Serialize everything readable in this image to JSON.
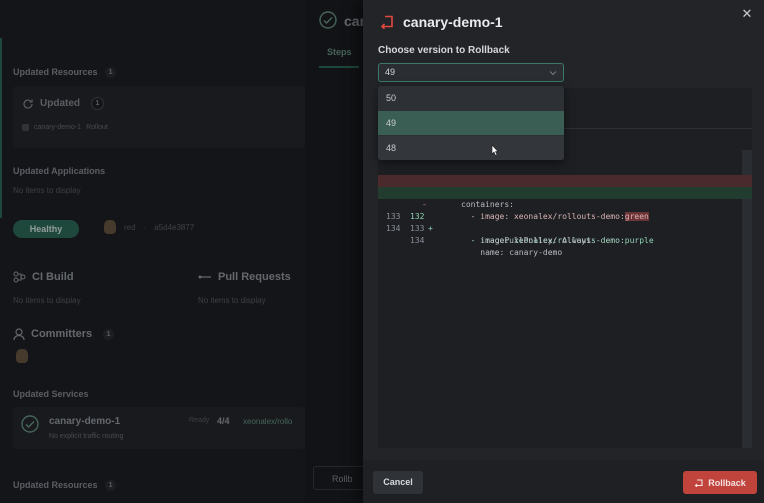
{
  "background": {
    "left": {
      "updated_resources_title": "Updated Resources",
      "updated_resources_count": "1",
      "updated_label": "Updated",
      "updated_count": "1",
      "resource_name": "canary-demo-1",
      "resource_kind": "Rollout",
      "updated_applications_title": "Updated Applications",
      "no_items": "No items to display",
      "healthy_badge": "Healthy",
      "user_name": "red",
      "commit_hash": "a5d4e3877",
      "ci_build_title": "CI Build",
      "ci_no_items": "No items to display",
      "pull_requests_title": "Pull Requests",
      "pr_no_items": "No items to display",
      "committers_title": "Committers",
      "committers_count": "1",
      "updated_services_title": "Updated Services",
      "service_name": "canary-demo-1",
      "service_sub": "No explicit traffic routing",
      "service_ratio_label": "Ready",
      "service_ratio": "4/4",
      "service_image": "xeonalex/rollo",
      "updated_resources_title_2": "Updated Resources",
      "updated_resources_count_2": "1"
    },
    "middle": {
      "title_partial": "car",
      "tab_steps": "Steps",
      "rollback_partial": "Rollb"
    }
  },
  "drawer": {
    "title": "canary-demo-1",
    "field_label": "Choose version to Rollback",
    "selected_value": "49",
    "options": [
      "50",
      "49",
      "48"
    ],
    "diff": [
      {
        "old": "131",
        "new": "131",
        "mark": "",
        "type": "ctx",
        "code": "containers:"
      },
      {
        "old": "132",
        "new": "",
        "mark": "-",
        "type": "del",
        "code": "  - image: xeonalex/rollouts-demo:",
        "hl": "green"
      },
      {
        "old": "",
        "new": "132",
        "mark": "+",
        "type": "add",
        "code": "  - image: xeonalex/rollouts-demo:",
        "hl": "purple"
      },
      {
        "old": "133",
        "new": "133",
        "mark": "",
        "type": "ctx",
        "code": "    imagePullPolicy: Always"
      },
      {
        "old": "134",
        "new": "134",
        "mark": "",
        "type": "ctx",
        "code": "    name: canary-demo"
      }
    ],
    "cancel_label": "Cancel",
    "rollback_label": "Rollback"
  },
  "colors": {
    "accent_green": "#2f6f5c",
    "danger": "#c0433c"
  }
}
